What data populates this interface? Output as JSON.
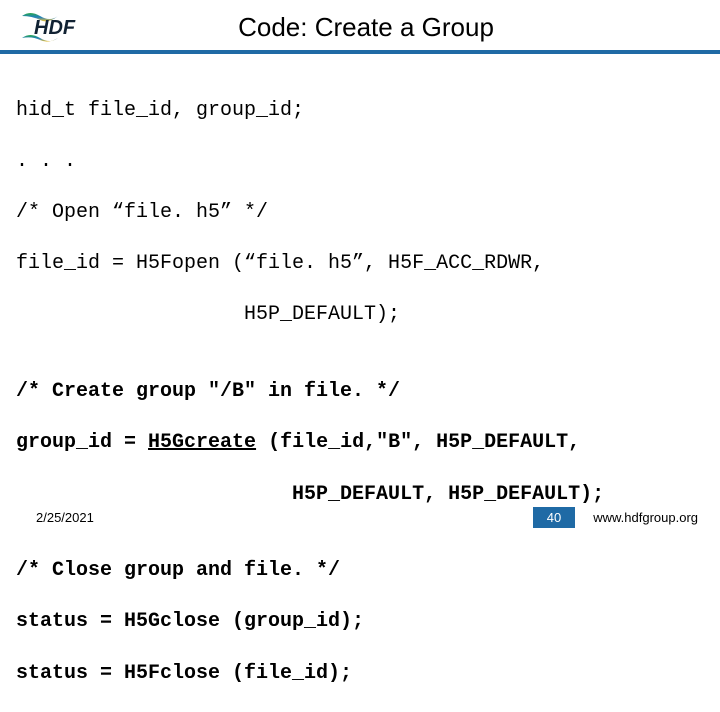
{
  "header": {
    "title": "Code: Create a Group"
  },
  "code": {
    "l1": "hid_t file_id, group_id;",
    "l2": ". . .",
    "l3": "/* Open “file. h5” */",
    "l4": "file_id = H5Fopen (“file. h5”, H5F_ACC_RDWR,",
    "l5": "                   H5P_DEFAULT);",
    "l6": "",
    "l7a": "/* Create group \"/B\" in file. */",
    "l7b": "group_id = ",
    "l7c": "H5Gcreate",
    "l7d": " (file_id,\"B\", H5P_DEFAULT,",
    "l8": "                       H5P_DEFAULT, H5P_DEFAULT);",
    "l9": "",
    "l10": "/* Close group and file. */",
    "l11": "status = H5Gclose (group_id);",
    "l12": "status = H5Fclose (file_id);"
  },
  "footer": {
    "date": "2/25/2021",
    "page": "40",
    "url": "www.hdfgroup.org"
  },
  "colors": {
    "rule": "#1f6aa5"
  }
}
